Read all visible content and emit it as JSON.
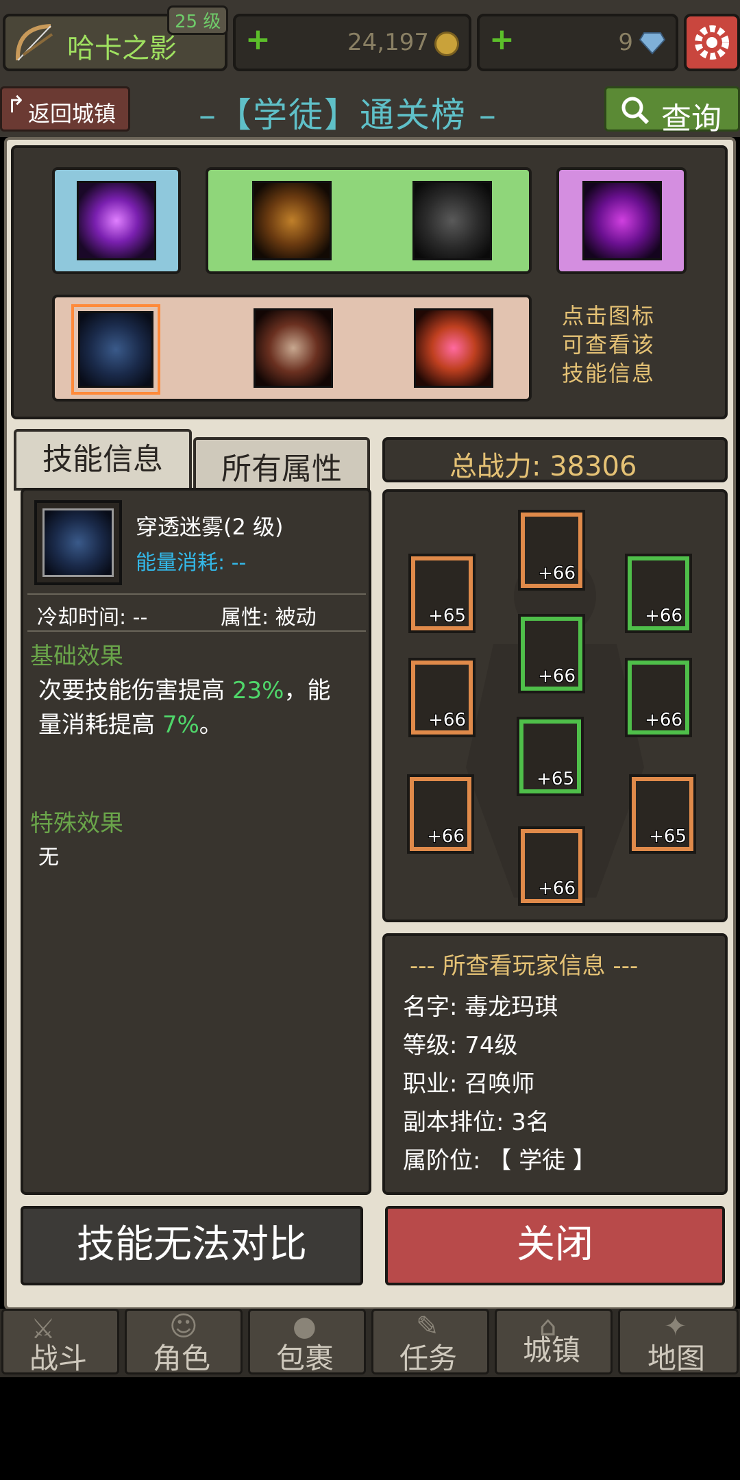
{
  "player": {
    "name": "哈卡之影",
    "level_badge": "25 级"
  },
  "resources": {
    "gold": "24,197",
    "gems": "9"
  },
  "nav": {
    "back_label": "返回城镇",
    "title": "–【学徒】通关榜 –",
    "search_label": "查询"
  },
  "skills_panel": {
    "hint_lines": [
      "点击图标",
      "可查看该",
      "技能信息"
    ]
  },
  "tabs": {
    "skill_info": "技能信息",
    "all_attrs": "所有属性"
  },
  "skill": {
    "name": "穿透迷雾(2 级)",
    "energy_label": "能量消耗: --",
    "cooldown": "冷却时间: --",
    "attribute": "属性: 被动",
    "basic_header": "基础效果",
    "basic_text_1": "次要技能伤害提高 ",
    "basic_pct_1": "23%",
    "basic_text_2": "，能",
    "basic_text_3": "量消耗提高 ",
    "basic_pct_2": "7%",
    "basic_text_4": "。",
    "special_header": "特殊效果",
    "special_text": "无"
  },
  "power": {
    "label": "总战力: 38306"
  },
  "equipment": [
    "+66",
    "+65",
    "+66",
    "+66",
    "+66",
    "+66",
    "+65",
    "+66",
    "+65",
    "+66"
  ],
  "player_info": {
    "header": "--- 所查看玩家信息 ---",
    "name": "名字: 毒龙玛琪",
    "level": "等级: 74级",
    "class": "职业: 召唤师",
    "rank": "副本排位: 3名",
    "tier": "属阶位: 【 学徒 】"
  },
  "buttons": {
    "compare": "技能无法对比",
    "close": "关闭"
  },
  "bottom_nav": [
    "战斗",
    "角色",
    "包裹",
    "任务",
    "城镇",
    "地图"
  ],
  "colors": {
    "accent_gold": "#e5c275",
    "energy_blue": "#33b8e8",
    "green": "#4fd66a",
    "close_red": "#b84a4a"
  }
}
